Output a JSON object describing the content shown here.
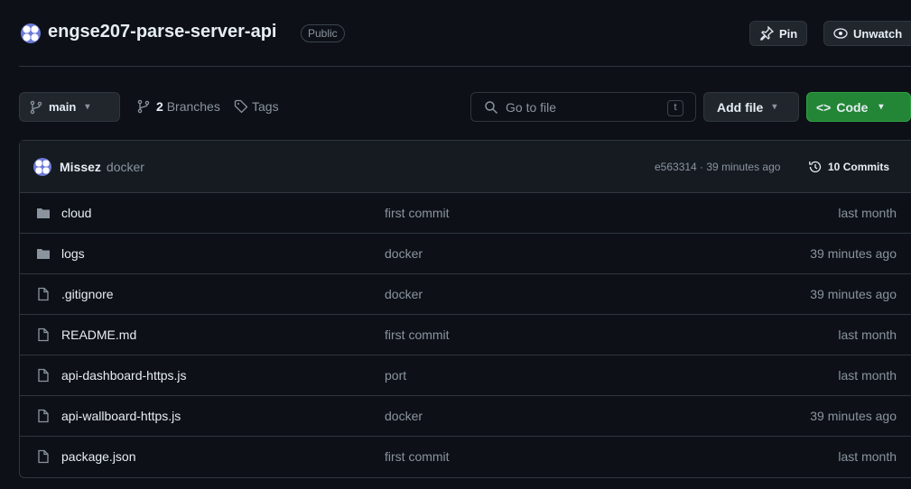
{
  "repo": {
    "name": "engse207-parse-server-api",
    "visibility": "Public",
    "pin_label": "Pin",
    "watch_label": "Unwatch"
  },
  "toolbar": {
    "branch": "main",
    "branches_count": "2",
    "branches_label": "Branches",
    "tags_label": "Tags",
    "search_placeholder": "Go to file",
    "search_shortcut": "t",
    "add_file_label": "Add file",
    "code_label": "Code"
  },
  "commit": {
    "author": "Missez",
    "message": "docker",
    "hash_time": "e563314 · 39 minutes ago",
    "commits_count": "10",
    "commits_label": "Commits"
  },
  "files": [
    {
      "type": "folder",
      "name": "cloud",
      "message": "first commit",
      "time": "last month"
    },
    {
      "type": "folder",
      "name": "logs",
      "message": "docker",
      "time": "39 minutes ago"
    },
    {
      "type": "file",
      "name": ".gitignore",
      "message": "docker",
      "time": "39 minutes ago"
    },
    {
      "type": "file",
      "name": "README.md",
      "message": "first commit",
      "time": "last month"
    },
    {
      "type": "file",
      "name": "api-dashboard-https.js",
      "message": "port",
      "time": "last month"
    },
    {
      "type": "file",
      "name": "api-wallboard-https.js",
      "message": "docker",
      "time": "39 minutes ago"
    },
    {
      "type": "file",
      "name": "package.json",
      "message": "first commit",
      "time": "last month"
    }
  ]
}
